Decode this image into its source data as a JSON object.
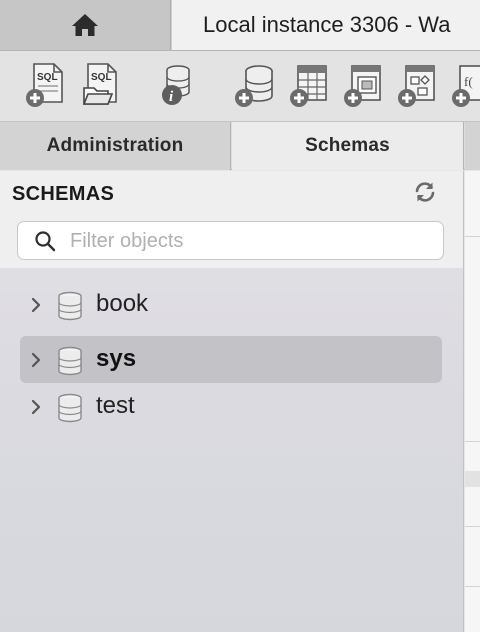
{
  "tabs": {
    "home_icon": "home-icon",
    "connection_title": "Local instance 3306 - Wa"
  },
  "toolbar": {
    "icons": [
      "new-sql-tab-icon",
      "open-sql-script-icon",
      "server-info-icon",
      "create-schema-icon",
      "create-table-icon",
      "create-view-icon",
      "create-procedure-icon",
      "create-function-icon"
    ]
  },
  "sidebar_tabs": {
    "administration": "Administration",
    "schemas": "Schemas"
  },
  "schemas_panel": {
    "title": "SCHEMAS",
    "search_placeholder": "Filter objects",
    "search_value": "",
    "items": [
      {
        "label": "book",
        "selected": false
      },
      {
        "label": "sys",
        "selected": true
      },
      {
        "label": "test",
        "selected": false
      }
    ]
  },
  "colors": {
    "selection": "#c3c2c7",
    "active_tab": "#f1f1f1"
  }
}
